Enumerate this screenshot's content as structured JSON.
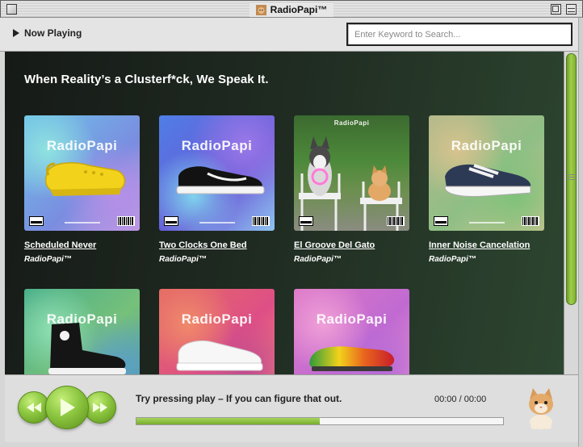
{
  "window": {
    "title": "RadioPapi™"
  },
  "toolbar": {
    "now_playing_label": "Now Playing",
    "search_placeholder": "Enter Keyword to Search..."
  },
  "main": {
    "tagline": "When Reality’s a Clusterf*ck, We Speak It.",
    "cover_brand": "RadioPapi",
    "albums": [
      {
        "title": "Scheduled Never",
        "artist": "RadioPapi™",
        "item": "yellow clog",
        "bg": "#5ea9d6"
      },
      {
        "title": "Two Clocks One Bed",
        "artist": "RadioPapi™",
        "item": "black sneaker",
        "bg": "#5d5fd0"
      },
      {
        "title": "El Groove Del Gato",
        "artist": "RadioPapi™",
        "item": "dog and cat photo",
        "bg": "#3f6b34"
      },
      {
        "title": "Inner Noise Cancelation",
        "artist": "RadioPapi™",
        "item": "white sneaker",
        "bg": "#9fbf8a"
      },
      {
        "title": "",
        "artist": "",
        "item": "high-top sneaker",
        "bg": "#58b08d"
      },
      {
        "title": "",
        "artist": "",
        "item": "white low sneaker",
        "bg": "#e2607a"
      },
      {
        "title": "",
        "artist": "",
        "item": "rainbow clog",
        "bg": "#d77fc8"
      }
    ]
  },
  "player": {
    "status_text": "Try pressing play  –  If you can figure that out.",
    "time_display": "00:00  /  00:00",
    "progress_fraction": 0.5,
    "accent_color": "#8cc63f"
  }
}
